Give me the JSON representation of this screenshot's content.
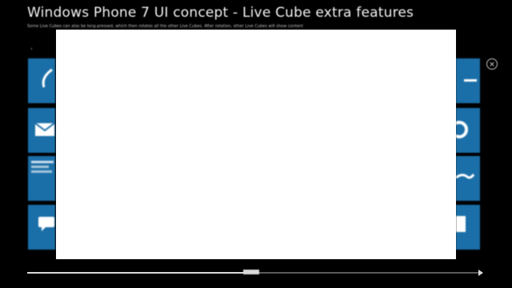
{
  "header": {
    "title": "Windows Phone 7 UI concept - Live Cube extra features",
    "subtitle": "Some Live Cubes can also be long-pressed, which then rotates all the other Live Cubes. After rotation, other Live Cubes will show content"
  },
  "back_marker": "‹",
  "tiles_left": [
    {
      "label": "",
      "icon": "phone-icon"
    },
    {
      "label": "",
      "icon": "mail-icon"
    },
    {
      "label": "",
      "icon": "text-preview"
    },
    {
      "label": "",
      "icon": "messaging-icon"
    }
  ],
  "tiles_right": [
    {
      "label": "",
      "icon": "blog-text"
    },
    {
      "label": "",
      "icon": "internet-explorer-icon"
    },
    {
      "label": "",
      "icon": "xbox-icon"
    },
    {
      "label": "",
      "icon": "marketplace-icon"
    }
  ],
  "close_button": "×",
  "captions": [
    "",
    "",
    "",
    ""
  ],
  "progress": {
    "fraction": 0.5,
    "thumb_label": ""
  },
  "colors": {
    "background": "#000000",
    "tile": "#1b6fa8",
    "overlay": "#ffffff"
  }
}
